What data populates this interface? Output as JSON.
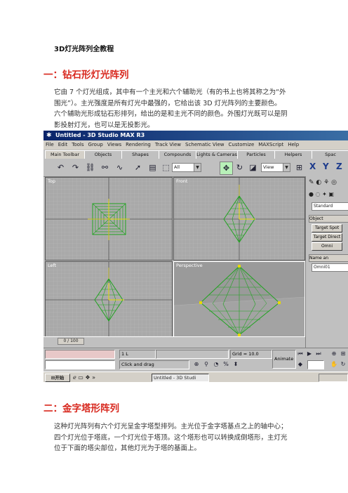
{
  "doc": {
    "title": "3D灯光阵列全教程",
    "section1": {
      "heading": "一：钻石形灯光阵列",
      "lines": [
        "它由 7 个灯光组成，其中有一个主光和六个辅助光（有的书上也将其称之为“外",
        "围光”）。主光强度是所有灯光中最强的，它给出该 3D 灯光阵列的主要颜色。",
        "六个辅助光形成钻石形排列，给出的是和主光不同的颜色。外围灯光既可以是阴",
        "影投射灯光，也可以是无投影光。"
      ]
    },
    "section2": {
      "heading": "二：金字塔形阵列",
      "lines": [
        "这种灯光阵列有六个灯光呈金字塔型排列。主光位于金字塔基点之上的轴中心；",
        "四个灯光位于塔底，一个灯光位于塔顶。这个塔形也可以转换成倒塔形，主灯光",
        "位于下面的塔尖部位，其他灯光为于塔的基面上。"
      ]
    }
  },
  "screenshot": {
    "window_title": "Untitled - 3D Studio MAX R3",
    "menu": [
      "File",
      "Edit",
      "Tools",
      "Group",
      "Views",
      "Rendering",
      "Track View",
      "Schematic View",
      "Customize",
      "MAXScript",
      "Help"
    ],
    "tabs": [
      "Main Toolbar",
      "Objects",
      "Shapes",
      "Compounds",
      "Lights & Cameras",
      "Particles",
      "Helpers",
      "Spac"
    ],
    "selection_filter": "All",
    "coord_system": "View",
    "axis_buttons": [
      "X",
      "Y",
      "Z"
    ],
    "viewports": {
      "top": "Top",
      "front": "Front",
      "left": "Left",
      "perspective": "Perspective"
    },
    "command_panel": {
      "category": "Standard",
      "rollout_object_type": "Object",
      "buttons": [
        "Target Spot",
        "Target Direct",
        "Omni"
      ],
      "rollout_name": "Name an",
      "name_value": "Omni01"
    },
    "timeline": {
      "frame": "0 / 100"
    },
    "status": {
      "prompt": "Click and drag",
      "lock": "1 L",
      "grid": "Grid = 10.0",
      "animate": "Animate"
    },
    "taskbar": {
      "start": "开始",
      "task": "Untitled - 3D Studi"
    },
    "colors": {
      "viewport_bg": "#a9a9a9",
      "wire": "#1fa31f",
      "title_bar": "#0a246a"
    }
  }
}
